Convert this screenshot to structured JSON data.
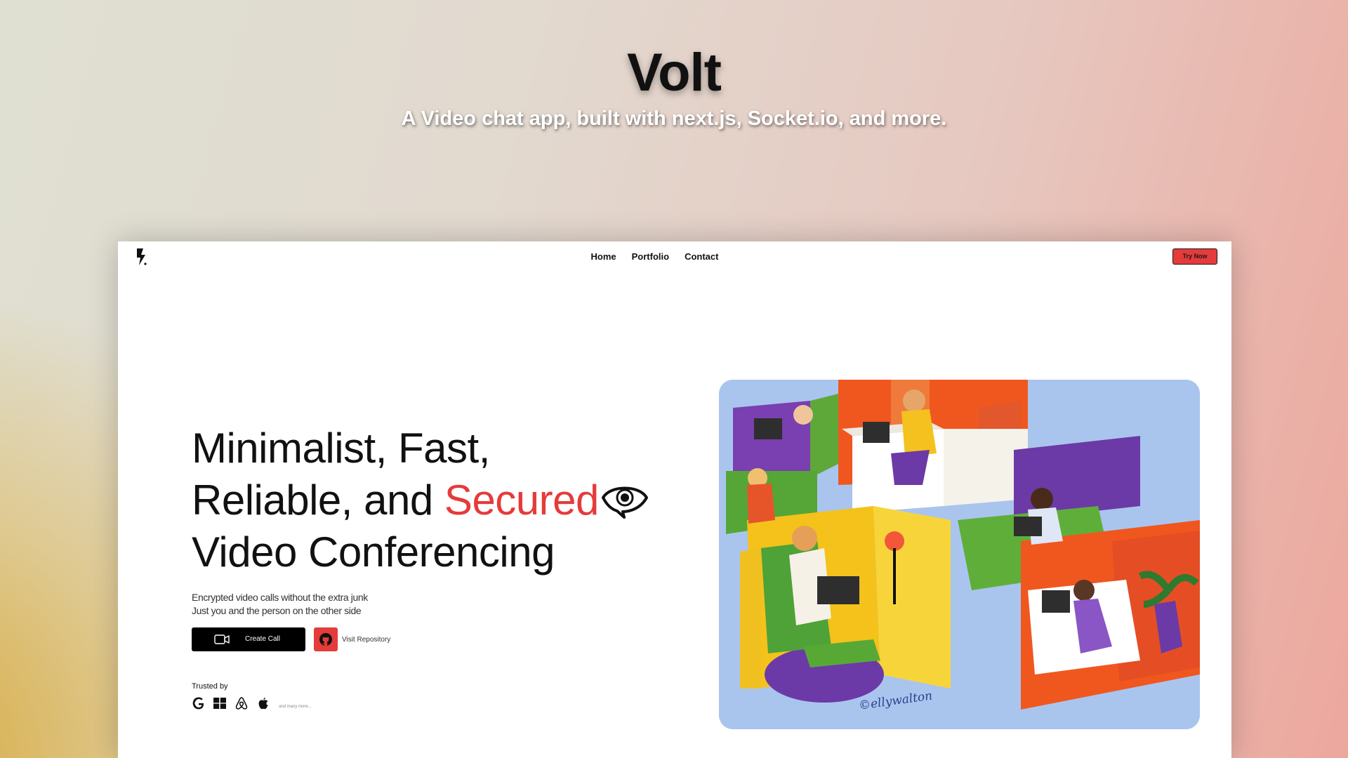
{
  "promo": {
    "title": "Volt",
    "subtitle": "A Video chat app, built  with next.js, Socket.io, and more."
  },
  "nav": {
    "links": [
      "Home",
      "Portfolio",
      "Contact"
    ],
    "cta": "Try Now"
  },
  "hero": {
    "line1": "Minimalist, Fast,",
    "line2_prefix": "Reliable, and ",
    "line2_accent": "Secured",
    "line3": "Video Conferencing",
    "desc1": "Encrypted video calls without the extra junk",
    "desc2": "Just you and the person on the other side",
    "create_label": "Create Call",
    "repo_label": "Visit Repository"
  },
  "trusted": {
    "label": "Trusted by",
    "logos": [
      "google-icon",
      "windows-icon",
      "airbnb-icon",
      "apple-icon"
    ],
    "more": "and many more..."
  },
  "illustration": {
    "signature": "©ellywalton"
  },
  "colors": {
    "accent": "#e53b3b",
    "text": "#111111",
    "button": "#000000"
  }
}
